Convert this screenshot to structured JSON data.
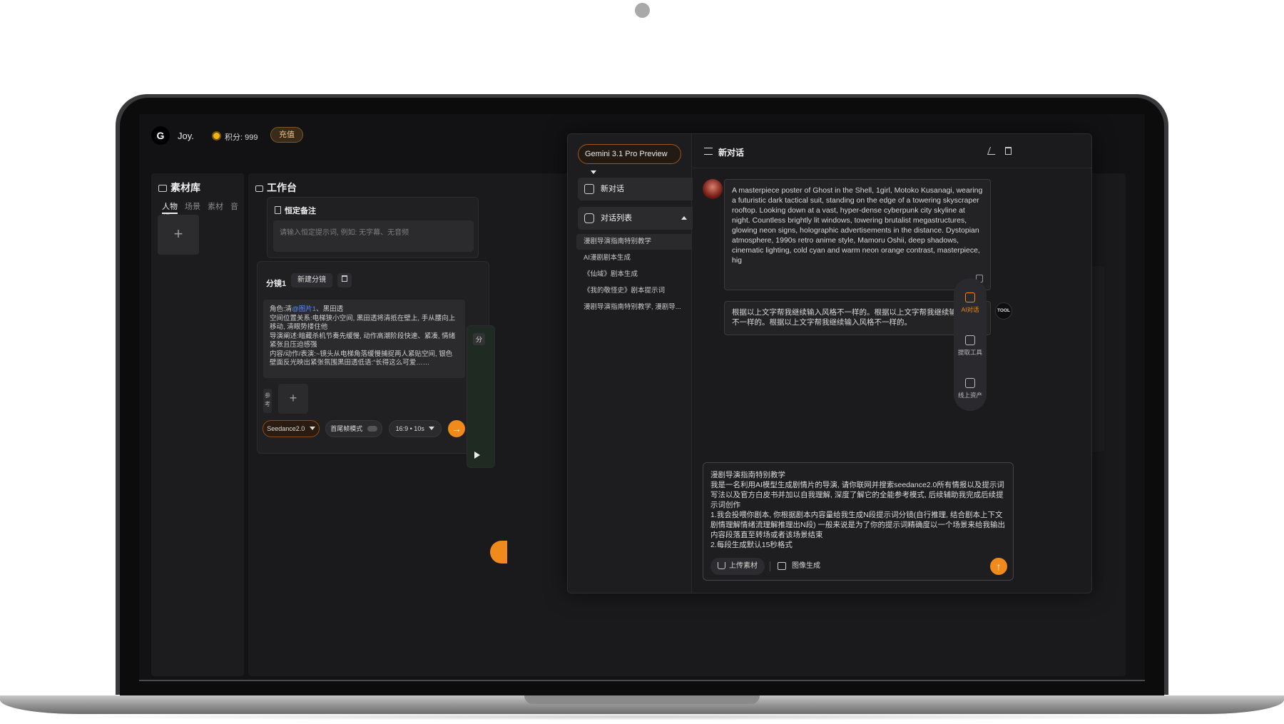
{
  "user": {
    "name": "Joy.",
    "points_label": "积分: 999",
    "recharge_label": "充值"
  },
  "library": {
    "title": "素材库",
    "tabs": [
      "人物",
      "场景",
      "素材",
      "音频"
    ],
    "add_label": "+"
  },
  "workbench": {
    "title": "工作台",
    "fixed_note": {
      "title": "恒定备注",
      "placeholder": "请输入恒定提示词, 例如: 无字幕、无音频"
    },
    "shot": {
      "label": "分镜1",
      "new_shot_label": "新建分镜",
      "script_lines": [
        "角色:清",
        "@图片1",
        "、黑田透",
        "空间位置关系:电梯狭小空间, 黑田透将清抵在壁上, 手从腰向上移动, 清眼势搂住他",
        "导演阐述:暗藏杀机节奏先缓慢, 动作高潮阶段快速、紧凑, 情绪紧张且压迫感强",
        "内容/动作/表演:~镜头从电梯角落缓慢捕捉两人紧贴空间, 银色壁面反光映出紧张氛围黑田透低语:“长得这么可爱……"
      ],
      "ref_label": "参考",
      "add_ref_label": "+",
      "model_label": "Seedance2.0",
      "mode_label": "首尾帧模式",
      "ratio_label": "16:9 • 10s",
      "next_shot_tag": "分"
    }
  },
  "chat": {
    "model": "Gemini 3.1 Pro Preview",
    "new_chat_label": "新对话",
    "list_label": "对话列表",
    "conversations": [
      "漫剧导演指南特别教学",
      "AI漫剧剧本生成",
      "《仙域》剧本生成",
      "《我的敬怪史》剧本提示词",
      "漫剧导演指南特别教学, 漫剧导..."
    ],
    "header_title": "新对话",
    "messages": [
      {
        "role": "assistant",
        "text": "A masterpiece poster of Ghost in the Shell, 1girl, Motoko Kusanagi, wearing a futuristic dark tactical suit, standing on the edge of a towering skyscraper rooftop. Looking down at a vast, hyper-dense cyberpunk city skyline at night. Countless brightly lit windows, towering brutalist megastructures, glowing neon signs, holographic advertisements in the distance. Dystopian atmosphere, 1990s retro anime style, Mamoru Oshii, deep shadows, cinematic lighting, cold cyan and warm neon orange contrast, masterpiece, hig"
      },
      {
        "role": "user",
        "text": "根据以上文字帮我继续输入风格不一样的。根据以上文字帮我继续输入风格不一样的。根据以上文字帮我继续输入风格不一样的。",
        "badge": "TOOL"
      }
    ],
    "composer_text": "漫剧导演指南特别教学\n我是一名利用AI模型生成剧情片的导演, 请你联网并搜索seedance2.0所有情报以及提示词写法以及官方白皮书并加以自我理解, 深度了解它的全能参考模式, 后续辅助我完成后续提示词创作\n1.我会投喂你剧本, 你根据剧本内容量给我生成N段提示词分镜(自行推理, 结合剧本上下文剧情理解情绪流理解推理出N段) 一般来说是为了你的提示词精确度以一个场景来给我输出内容段落直至转场或者该场景结束\n2.每段生成默认15秒格式",
    "upload_label": "上传素材",
    "image_gen_label": "图像生成"
  },
  "rail": [
    {
      "label": "AI对话",
      "icon": "ai-chat-icon",
      "active": true
    },
    {
      "label": "提取工具",
      "icon": "extract-tool-icon",
      "active": false
    },
    {
      "label": "线上资产",
      "icon": "online-assets-icon",
      "active": false
    }
  ],
  "colors": {
    "accent": "#f08a1a",
    "background": "#121214",
    "panel": "#1b1b1d"
  }
}
